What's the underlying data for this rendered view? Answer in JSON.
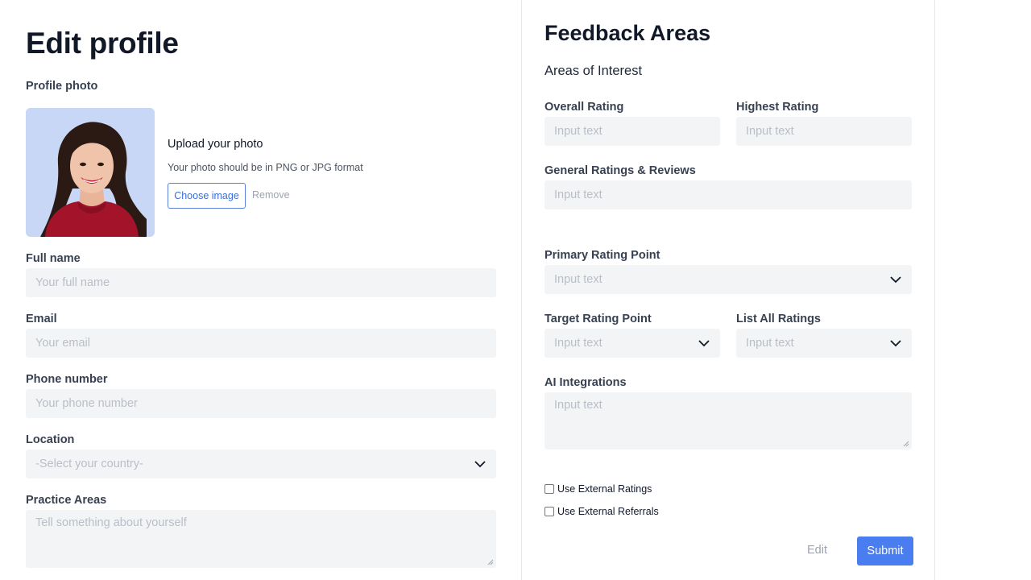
{
  "profile": {
    "title": "Edit profile",
    "photo_label": "Profile photo",
    "upload_title": "Upload your photo",
    "upload_hint": "Your photo should be in PNG or JPG format",
    "choose_label": "Choose image",
    "remove_label": "Remove",
    "full_name": {
      "label": "Full name",
      "placeholder": "Your full name",
      "value": ""
    },
    "email": {
      "label": "Email",
      "placeholder": "Your email",
      "value": ""
    },
    "phone": {
      "label": "Phone number",
      "placeholder": "Your phone number",
      "value": ""
    },
    "location": {
      "label": "Location",
      "selected": "-Select your country-"
    },
    "practice": {
      "label": "Practice Areas",
      "placeholder": "Tell something about yourself",
      "value": ""
    }
  },
  "feedback": {
    "title": "Feedback Areas",
    "subtitle": "Areas of Interest",
    "overall": {
      "label": "Overall Rating",
      "placeholder": "Input text"
    },
    "highest": {
      "label": "Highest Rating",
      "placeholder": "Input text"
    },
    "general": {
      "label": "General Ratings & Reviews",
      "placeholder": "Input text"
    },
    "primary": {
      "label": "Primary Rating Point",
      "selected": "Input text"
    },
    "target": {
      "label": "Target Rating Point",
      "selected": "Input text"
    },
    "list_all": {
      "label": "List All Ratings",
      "selected": "Input text"
    },
    "ai": {
      "label": "AI Integrations",
      "placeholder": "Input text"
    },
    "check_ratings": {
      "label": "Use External Ratings",
      "checked": false
    },
    "check_referrals": {
      "label": "Use External Referrals",
      "checked": false
    },
    "edit_label": "Edit",
    "submit_label": "Submit"
  },
  "colors": {
    "accent": "#4a7df0",
    "field_bg": "#f3f4f6",
    "photo_bg": "#c9d7f7"
  },
  "icons": {
    "select": "chevron-down-icon",
    "resize": "resize-grip-icon"
  }
}
